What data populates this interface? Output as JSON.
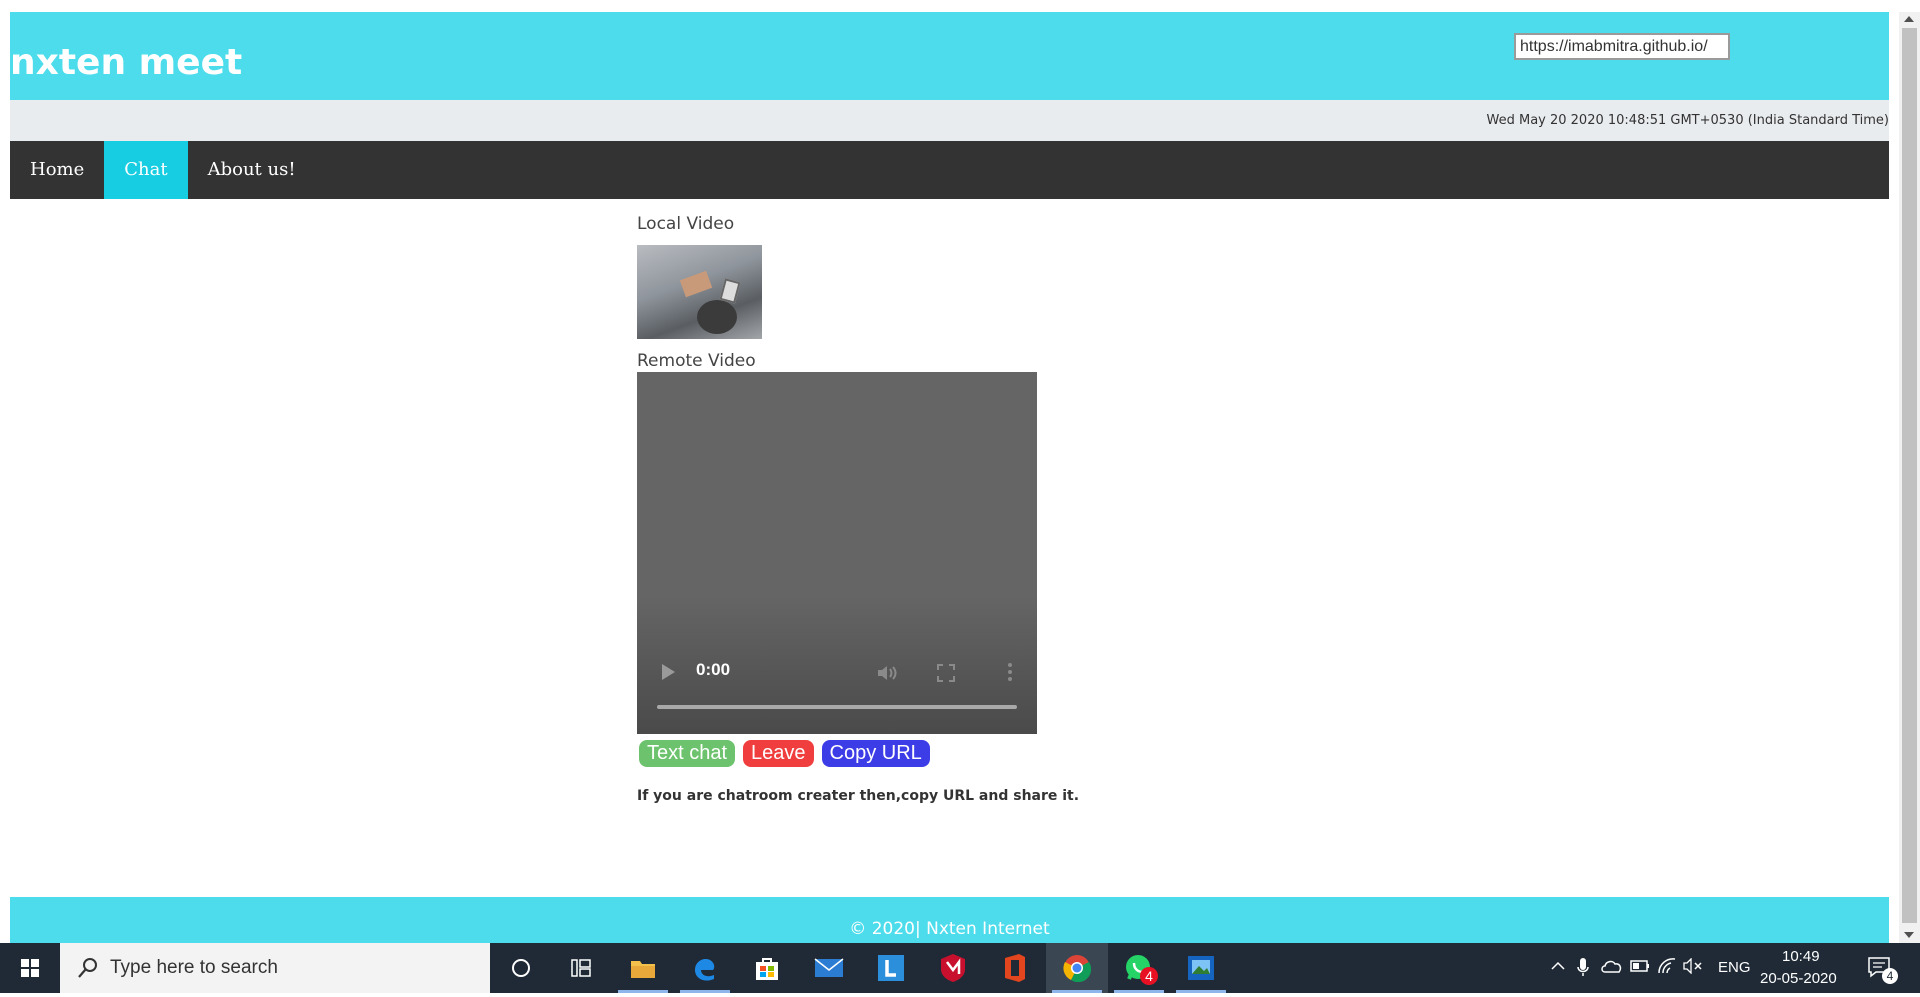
{
  "header": {
    "site_title": "nxten meet",
    "url_value": "https://imabmitra.github.io/"
  },
  "date_strip": {
    "datetime": "Wed May 20 2020 10:48:51 GMT+0530 (India Standard Time)"
  },
  "nav": {
    "items": [
      {
        "label": "Home"
      },
      {
        "label": "Chat",
        "active": true
      },
      {
        "label": "About us!"
      }
    ]
  },
  "main": {
    "local_video_label": "Local Video",
    "remote_video_label": "Remote Video",
    "remote_player": {
      "time": "0:00",
      "icons": [
        "play-icon",
        "volume-icon",
        "fullscreen-icon",
        "more-icon"
      ]
    },
    "buttons": {
      "text_chat": "Text chat",
      "leave": "Leave",
      "copy_url": "Copy URL"
    },
    "button_colors": {
      "text_chat": "#6dc26d",
      "leave": "#f03d3d",
      "copy_url": "#3d3de8"
    },
    "hint": "If you are chatroom creater then,copy URL and share it."
  },
  "footer": {
    "text": "© 2020| Nxten Internet"
  },
  "colors": {
    "header_bg": "#4cdcec",
    "nav_bg": "#333333",
    "nav_active": "#17cde2"
  },
  "taskbar": {
    "search_placeholder": "Type here to search",
    "apps": [
      "cortana-icon",
      "task-view-icon",
      "file-explorer-icon",
      "edge-icon",
      "store-icon",
      "mail-icon",
      "app-l-icon",
      "mcafee-icon",
      "office-icon",
      "chrome-icon",
      "whatsapp-icon",
      "photos-icon"
    ],
    "whatsapp_badge": "4",
    "language": "ENG",
    "time": "10:49",
    "date": "20-05-2020",
    "notification_count": "4"
  }
}
